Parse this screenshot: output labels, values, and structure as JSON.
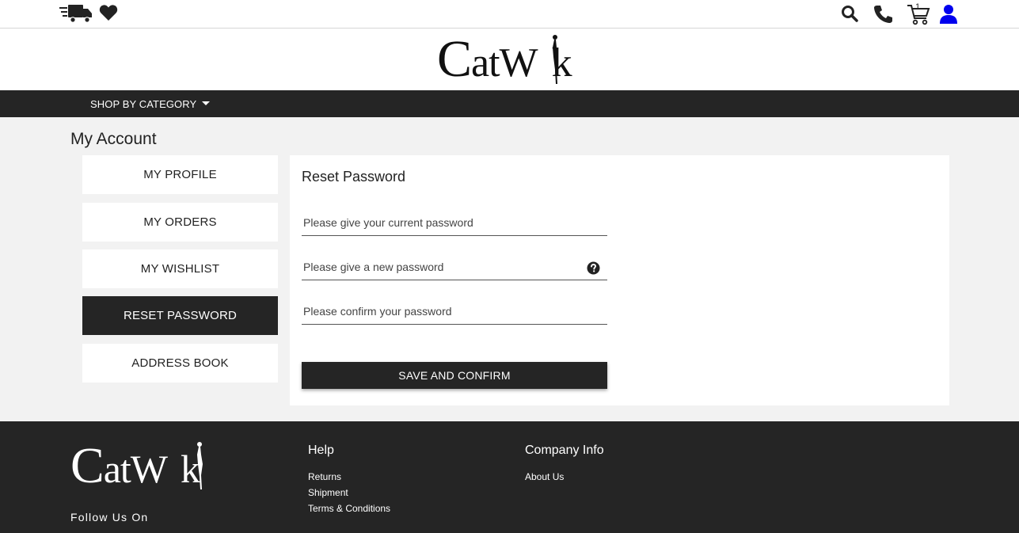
{
  "header": {
    "cart_count": "1",
    "brand": "CatWalk"
  },
  "nav": {
    "category_label": "SHOP BY CATEGORY"
  },
  "account": {
    "title": "My Account",
    "menu": [
      {
        "label": "MY PROFILE",
        "active": false
      },
      {
        "label": "MY ORDERS",
        "active": false
      },
      {
        "label": "MY WISHLIST",
        "active": false
      },
      {
        "label": "RESET PASSWORD",
        "active": true
      },
      {
        "label": "ADDRESS BOOK",
        "active": false
      }
    ]
  },
  "reset_form": {
    "title": "Reset Password",
    "current_placeholder": "Please give your current password",
    "new_placeholder": "Please give a new password",
    "confirm_placeholder": "Please confirm your password",
    "save_label": "SAVE AND CONFIRM"
  },
  "footer": {
    "brand": "CatWalk",
    "follow_label": "Follow Us On",
    "help_heading": "Help",
    "help_links": [
      "Returns",
      "Shipment",
      "Terms & Conditions"
    ],
    "company_heading": "Company Info",
    "company_links": [
      "About Us"
    ]
  },
  "colors": {
    "dark_bar": "#252525",
    "page_bg": "#f2f2f2",
    "user_icon": "#0000ee"
  },
  "icons": [
    "truck-icon",
    "heart-icon",
    "search-icon",
    "phone-icon",
    "cart-icon",
    "user-icon",
    "question-circle-icon",
    "caret-down-icon"
  ]
}
